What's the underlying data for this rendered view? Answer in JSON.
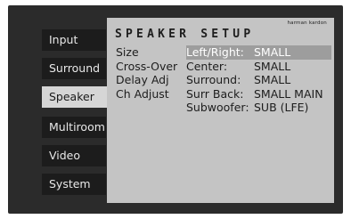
{
  "sidebar": {
    "items": [
      {
        "label": "Input"
      },
      {
        "label": "Surround"
      },
      {
        "label": "Speaker"
      },
      {
        "label": "Multiroom"
      },
      {
        "label": "Video"
      },
      {
        "label": "System"
      }
    ],
    "active_index": 2
  },
  "panel": {
    "brand": "harman kardon",
    "title": "SPEAKER SETUP",
    "menu": [
      "Size",
      "Cross-Over",
      "Delay Adj",
      "Ch Adjust"
    ],
    "settings": [
      {
        "label": "Left/Right:",
        "value": "SMALL"
      },
      {
        "label": "Center:",
        "value": "SMALL"
      },
      {
        "label": "Surround:",
        "value": "SMALL"
      },
      {
        "label": "Surr Back:",
        "value": "SMALL MAIN"
      },
      {
        "label": "Subwoofer:",
        "value": "SUB (LFE)"
      }
    ],
    "selected_setting_index": 0
  },
  "colors": {
    "background": "#2b2b2b",
    "panel": "#c4c4c4",
    "highlight": "#9d9d9d"
  }
}
